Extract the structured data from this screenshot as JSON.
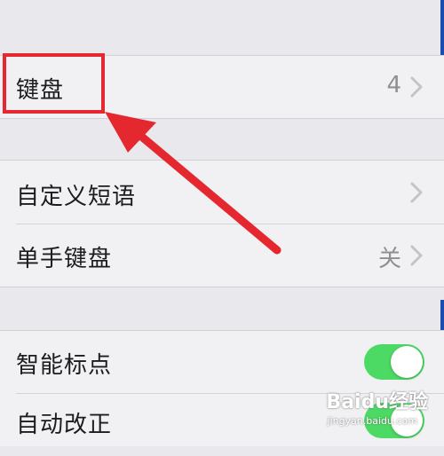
{
  "settings": {
    "keyboards": {
      "label": "键盘",
      "value": "4"
    },
    "text_replacement": {
      "label": "自定义短语"
    },
    "one_handed_keyboard": {
      "label": "单手键盘",
      "value": "关"
    },
    "smart_punctuation": {
      "label": "智能标点",
      "on": true
    },
    "auto_correction": {
      "label": "自动改正",
      "on": true
    }
  },
  "watermark": {
    "text": "Baidu经验",
    "sub": "jingyan.baidu.com"
  },
  "colors": {
    "highlight": "#e5272f",
    "toggle_on": "#4cd964",
    "background": "#e9e8ed"
  }
}
